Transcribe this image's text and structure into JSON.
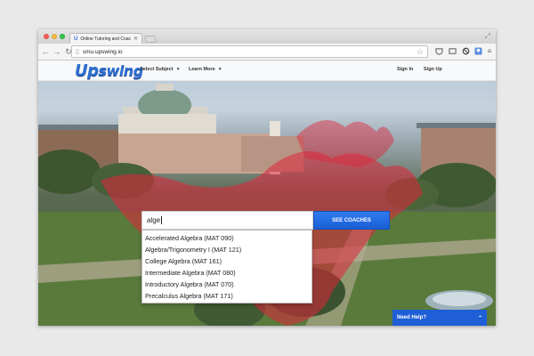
{
  "browser": {
    "tab_favicon": "U",
    "tab_title": "Online Tutoring and Coac",
    "tab_close": "✕",
    "url": "smu.upswing.io",
    "nav": {
      "back": "←",
      "forward": "→",
      "reload": "↻"
    },
    "icons": {
      "star": "star-icon",
      "pocket": "pocket-icon",
      "cast": "cast-icon",
      "adblock": "block-icon",
      "profile": "profile-icon",
      "menu": "menu-icon"
    },
    "glyphs": {
      "star": "☆",
      "menu": "≡",
      "fullscreen": "⤢"
    }
  },
  "site": {
    "logo_up": "Up",
    "logo_rest": "swing",
    "nav": {
      "select_subject": "Select Subject",
      "learn_more": "Learn More",
      "sign_in": "Sign In",
      "sign_up": "Sign Up",
      "caret": "▼"
    }
  },
  "search": {
    "value": "alge",
    "button": "SEE COACHES"
  },
  "suggestions": [
    "Accelerated Algebra (MAT 090)",
    "Algebra/Trigonometry I (MAT 121)",
    "College Algebra (MAT 161)",
    "Intermediate Algebra (MAT 080)",
    "Introductory Algebra (MAT 070)",
    "Precalculus Algebra (MAT 171)"
  ],
  "help": {
    "label": "Need Help?",
    "chevron": "⌃"
  },
  "colors": {
    "accent": "#2f6fd0",
    "button": "#1a5fd4",
    "mascot": "#e0243a"
  }
}
